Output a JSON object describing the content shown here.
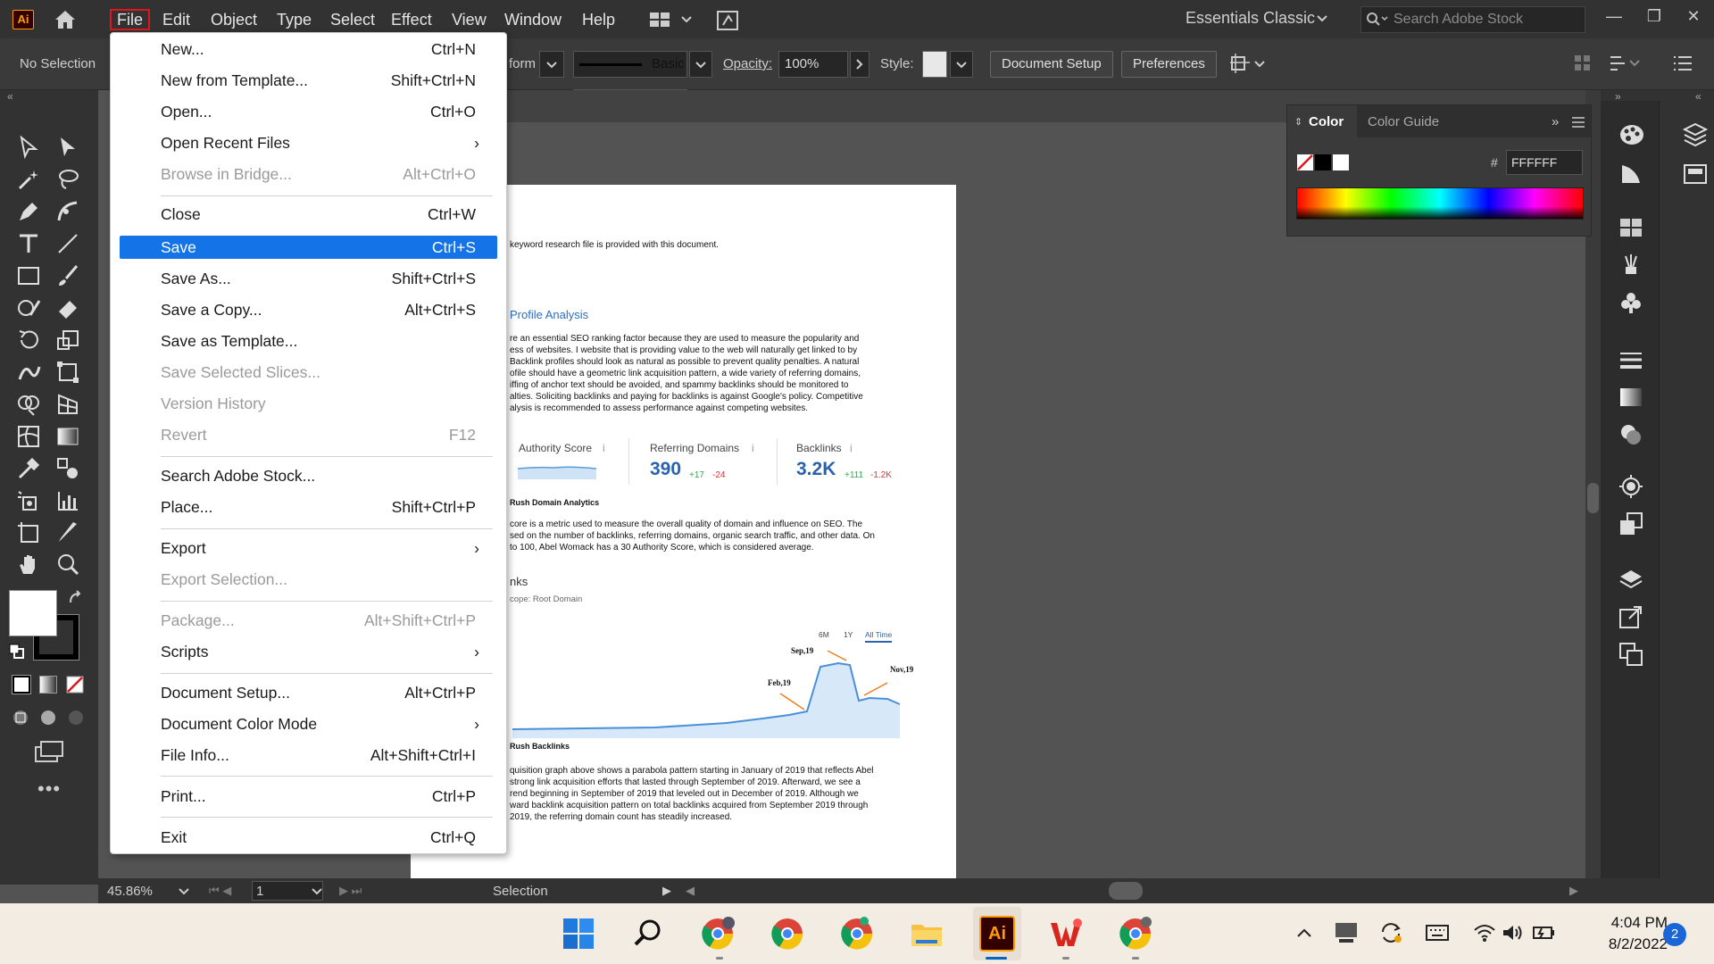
{
  "app": {
    "logo": "Ai"
  },
  "menubar": {
    "items": [
      "File",
      "Edit",
      "Object",
      "Type",
      "Select",
      "Effect",
      "View",
      "Window",
      "Help"
    ],
    "workspace": "Essentials Classic",
    "stock_search_placeholder": "Search Adobe Stock"
  },
  "controlbar": {
    "selection": "No Selection",
    "transform_partial": "form",
    "stroke_style": "Basic",
    "opacity_label": "Opacity:",
    "opacity_value": "100%",
    "style_label": "Style:",
    "document_setup": "Document Setup",
    "preferences": "Preferences"
  },
  "color_panel": {
    "tab_color": "Color",
    "tab_guide": "Color Guide",
    "hex_symbol": "#",
    "hex_value": "FFFFFF"
  },
  "file_menu": {
    "items": [
      {
        "label": "New...",
        "shortcut": "Ctrl+N"
      },
      {
        "label": "New from Template...",
        "shortcut": "Shift+Ctrl+N"
      },
      {
        "label": "Open...",
        "shortcut": "Ctrl+O"
      },
      {
        "label": "Open Recent Files",
        "shortcut": ""
      },
      {
        "label": "Browse in Bridge...",
        "shortcut": "Alt+Ctrl+O"
      },
      {
        "label": "Close",
        "shortcut": "Ctrl+W"
      },
      {
        "label": "Save",
        "shortcut": "Ctrl+S"
      },
      {
        "label": "Save As...",
        "shortcut": "Shift+Ctrl+S"
      },
      {
        "label": "Save a Copy...",
        "shortcut": "Alt+Ctrl+S"
      },
      {
        "label": "Save as Template...",
        "shortcut": ""
      },
      {
        "label": "Save Selected Slices...",
        "shortcut": ""
      },
      {
        "label": "Version History",
        "shortcut": ""
      },
      {
        "label": "Revert",
        "shortcut": "F12"
      },
      {
        "label": "Search Adobe Stock...",
        "shortcut": ""
      },
      {
        "label": "Place...",
        "shortcut": "Shift+Ctrl+P"
      },
      {
        "label": "Export",
        "shortcut": ""
      },
      {
        "label": "Export Selection...",
        "shortcut": ""
      },
      {
        "label": "Package...",
        "shortcut": "Alt+Shift+Ctrl+P"
      },
      {
        "label": "Scripts",
        "shortcut": ""
      },
      {
        "label": "Document Setup...",
        "shortcut": "Alt+Ctrl+P"
      },
      {
        "label": "Document Color Mode",
        "shortcut": ""
      },
      {
        "label": "File Info...",
        "shortcut": "Alt+Shift+Ctrl+I"
      },
      {
        "label": "Print...",
        "shortcut": "Ctrl+P"
      },
      {
        "label": "Exit",
        "shortcut": "Ctrl+Q"
      }
    ]
  },
  "document": {
    "line1": "keyword research file is provided with this document.",
    "heading1": "Profile Analysis",
    "para1": [
      "re an essential SEO ranking factor because they are used to measure the popularity and",
      "ess of websites. I website that is providing value to the web will naturally get linked to by",
      "Backlink profiles should look as natural as possible to prevent quality penalties. A natural",
      "ofile should have a geometric link acquisition pattern, a wide variety of referring domains,",
      "iffing of anchor text should be avoided, and spammy backlinks should be monitored to",
      "alties. Soliciting backlinks and paying for backlinks is against Google's policy. Competitive",
      "alysis is recommended to assess performance against competing websites."
    ],
    "metrics": {
      "authority_label": "Authority Score",
      "referring_label": "Referring Domains",
      "referring_value": "390",
      "referring_up": "+17",
      "referring_down": "-24",
      "backlinks_label": "Backlinks",
      "backlinks_value": "3.2K",
      "backlinks_up": "+111",
      "backlinks_down": "-1.2K",
      "info_glyph": "i"
    },
    "caption1": "Rush Domain Analytics",
    "para2": [
      "core is a metric used to measure the overall quality of domain and influence on SEO. The",
      "sed on the number of backlinks, referring domains, organic search traffic, and other data. On",
      "to 100, Abel Womack has a 30 Authority Score, which is considered average."
    ],
    "heading2": "nks",
    "scope": "cope: Root Domain",
    "chart_tabs": [
      "6M",
      "1Y",
      "All Time"
    ],
    "chart_annotations": [
      "Sep,19",
      "Feb,19",
      "Nov,19"
    ],
    "caption2": "Rush Backlinks",
    "para3": [
      "quisition graph above shows a parabola pattern starting in January of 2019 that reflects Abel",
      "strong link acquisition efforts that lasted through September of 2019. Afterward, we see a",
      "rend beginning in September of 2019 that leveled out in December of 2019. Although we",
      "ward backlink acquisition pattern on total backlinks acquired from September 2019 through",
      "2019, the referring domain count has steadily increased."
    ]
  },
  "statusbar": {
    "zoom": "45.86%",
    "artboard": "1",
    "mode": "Selection"
  },
  "taskbar": {
    "time": "4:04 PM",
    "date": "8/2/2022",
    "notifications": "2",
    "ai_label": "Ai"
  }
}
